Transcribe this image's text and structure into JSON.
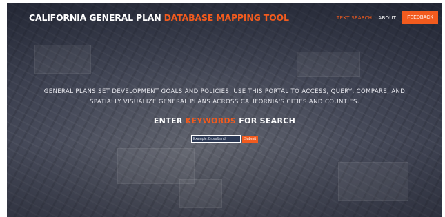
{
  "navbar": {
    "brand_main": "CALIFORNIA GENERAL PLAN ",
    "brand_accent": "DATABASE MAPPING TOOL",
    "links": [
      {
        "label": "TEXT SEARCH"
      },
      {
        "label": "ABOUT"
      }
    ],
    "feedback_label": "FEEDBACK"
  },
  "hero": {
    "description": "GENERAL PLANS SET DEVELOPMENT GOALS AND POLICIES. USE THIS PORTAL TO ACCESS, QUERY, COMPARE, AND SPATIALLY VISUALIZE GENERAL PLANS ACROSS CALIFORNIA'S CITIES AND COUNTIES.",
    "heading_prefix": "ENTER ",
    "heading_accent": "KEYWORDS",
    "heading_suffix": " FOR SEARCH",
    "search_placeholder": "Example: Broadband",
    "submit_label": "Submit"
  },
  "colors": {
    "accent": "#f25b1e",
    "text": "#ffffff",
    "overlay": "#3a3f4f"
  }
}
